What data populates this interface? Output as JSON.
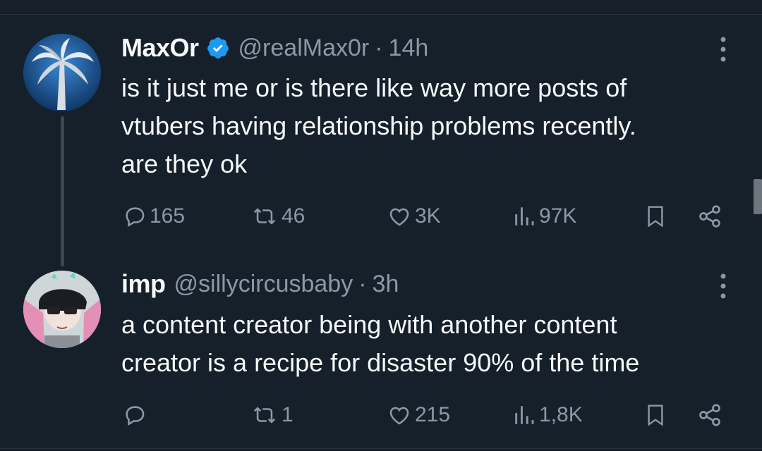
{
  "tweets": [
    {
      "name": "MaxOr",
      "verified": true,
      "handle": "@realMax0r",
      "separator": "·",
      "time": "14h",
      "text": "is it just me or is there like way more posts of\nvtubers having relationship problems recently.\nare they ok",
      "replies": "165",
      "reposts": "46",
      "likes": "3K",
      "views": "97K"
    },
    {
      "name": "imp",
      "verified": false,
      "handle": "@sillycircusbaby",
      "separator": "·",
      "time": "3h",
      "text": "a content creator being with another content\ncreator is a recipe for disaster 90% of the time",
      "replies": "",
      "reposts": "1",
      "likes": "215",
      "views": "1,8K"
    }
  ],
  "icons": {
    "reply": "reply-icon",
    "repost": "repost-icon",
    "like": "heart-icon",
    "views": "views-icon",
    "bookmark": "bookmark-icon",
    "share": "share-icon",
    "more": "more-icon",
    "verified": "verified-badge-icon"
  },
  "colors": {
    "background": "#15202b",
    "text": "#f7f9f9",
    "muted": "#8b98a5",
    "verified": "#1d9bf0"
  }
}
